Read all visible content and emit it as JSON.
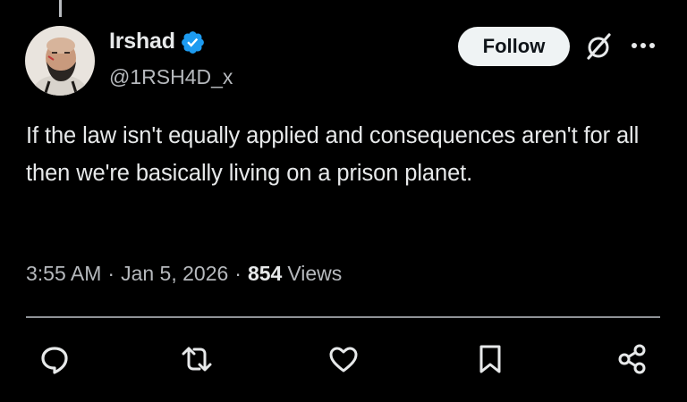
{
  "post": {
    "author": {
      "display_name": "Irshad",
      "handle": "@1RSH4D_x",
      "verified": true,
      "avatar_icon": "avatar-portrait"
    },
    "follow_label": "Follow",
    "text": "If the law isn't equally applied and consequences aren't for all then we're basically living on a prison planet.",
    "time": "3:55 AM",
    "separator": "·",
    "date": "Jan 5, 2026",
    "views_count": "854",
    "views_label": "Views"
  },
  "icons": {
    "verified": "verified-badge-icon",
    "grok": "grok-icon",
    "more": "more-options-icon",
    "reply": "reply-icon",
    "repost": "repost-icon",
    "like": "like-icon",
    "bookmark": "bookmark-icon",
    "share": "share-icon"
  },
  "colors": {
    "background": "#000000",
    "text_primary": "#e7e9ea",
    "text_secondary": "#b6b9bd",
    "verified_blue": "#1d9bf0",
    "follow_bg": "#eff3f4",
    "follow_text": "#0f1419"
  }
}
